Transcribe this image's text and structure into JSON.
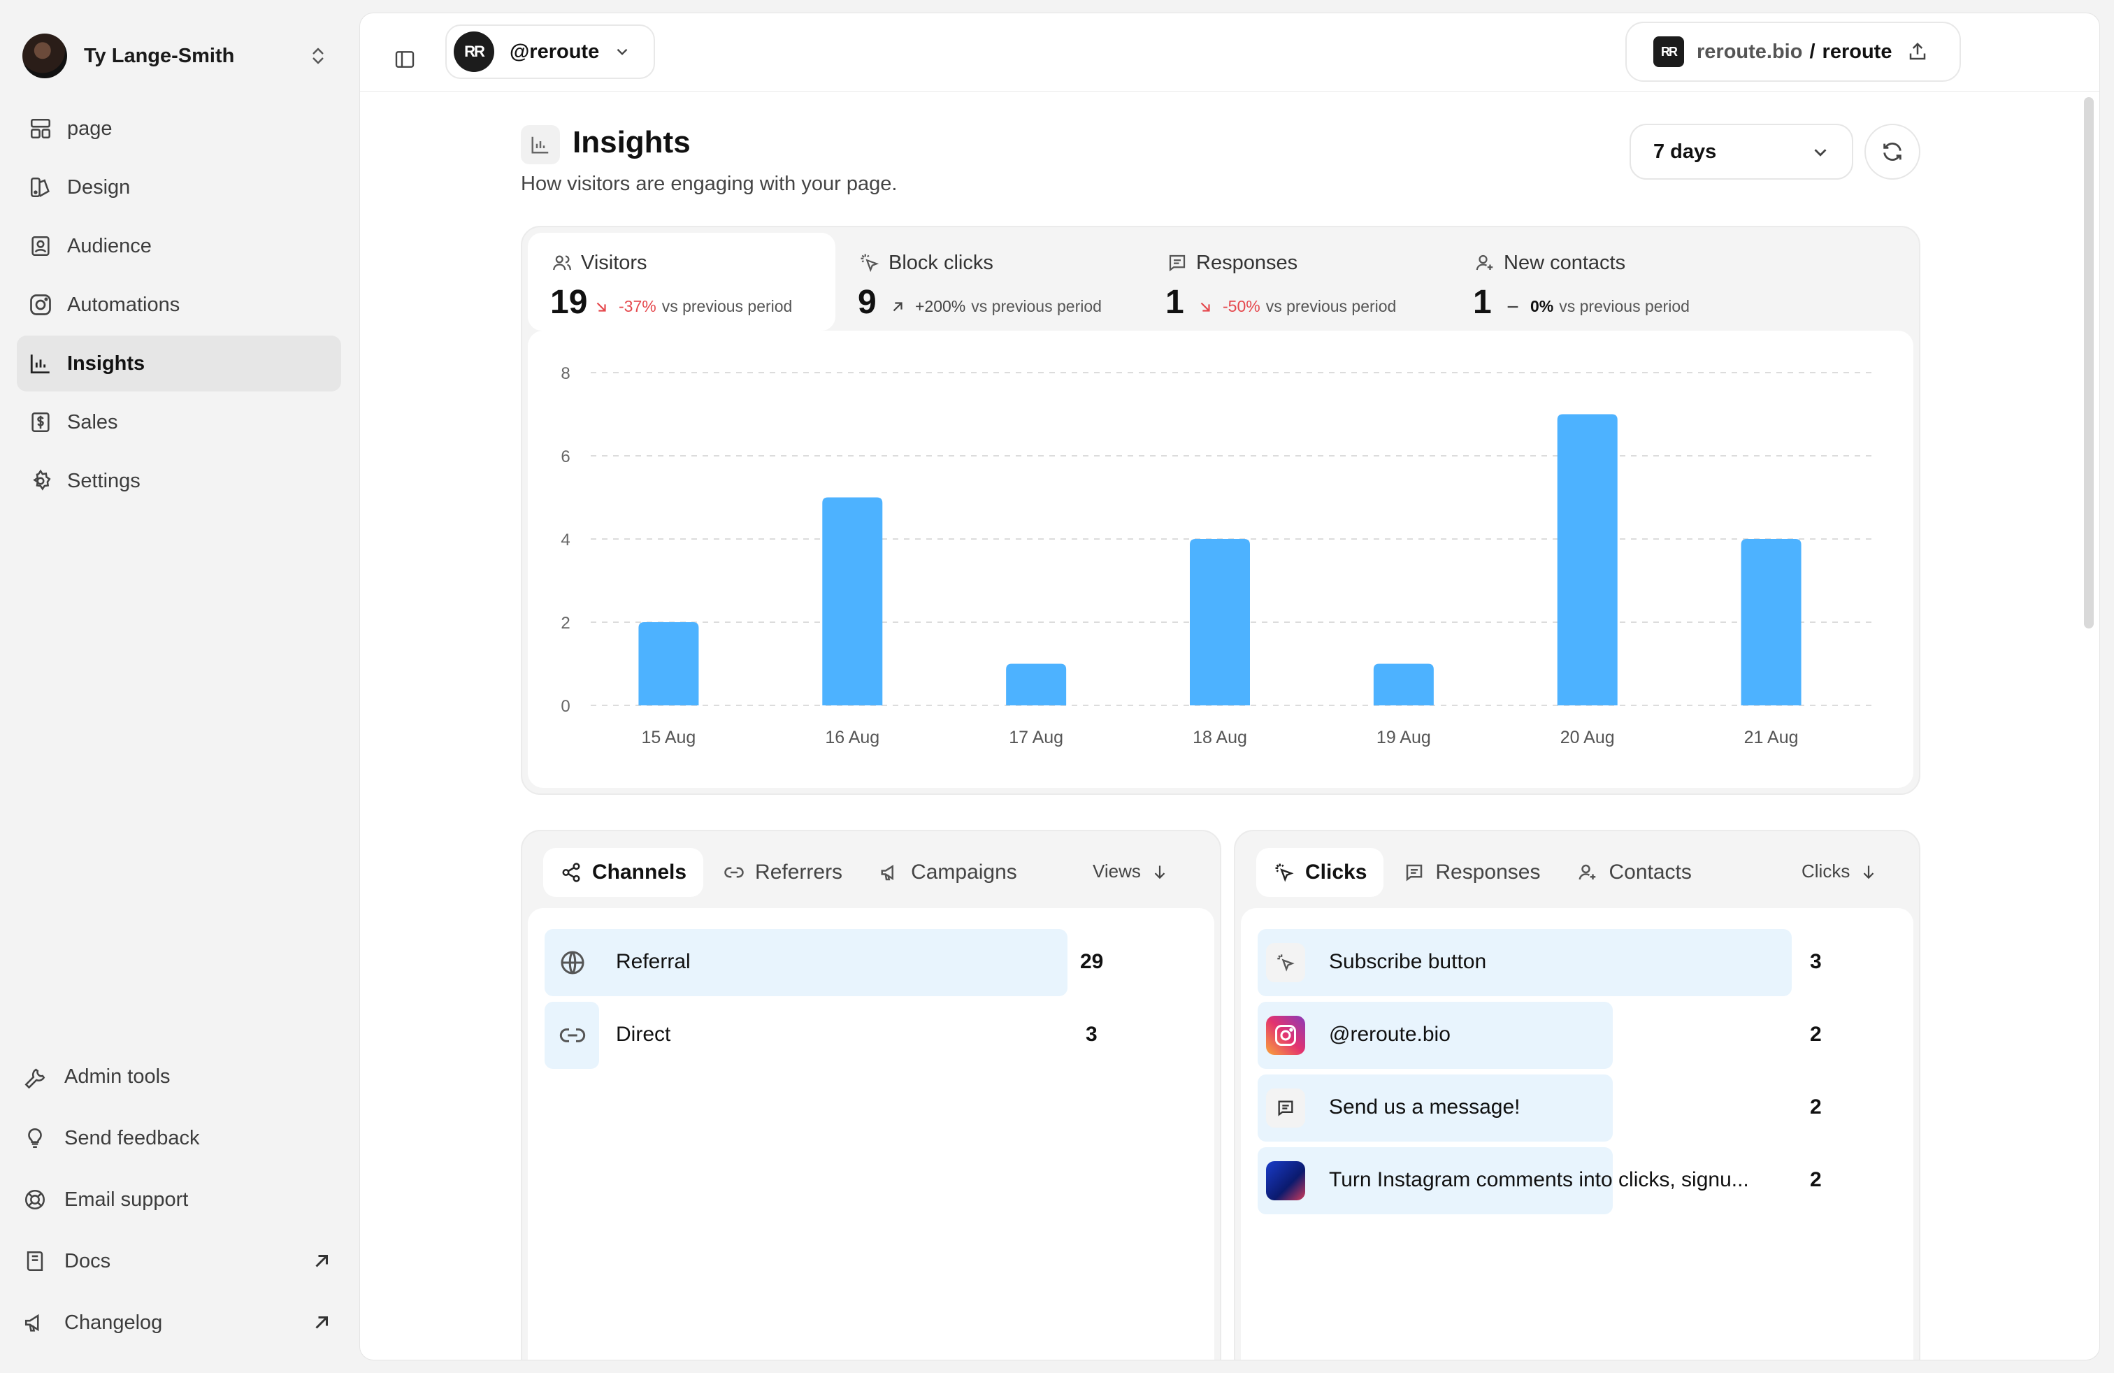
{
  "sidebar": {
    "user_name": "Ty Lange-Smith",
    "nav": [
      {
        "label": "page",
        "icon": "layout-icon"
      },
      {
        "label": "Design",
        "icon": "palette-icon"
      },
      {
        "label": "Audience",
        "icon": "contact-book-icon"
      },
      {
        "label": "Automations",
        "icon": "instagram-icon"
      },
      {
        "label": "Insights",
        "icon": "bar-chart-icon",
        "active": true
      },
      {
        "label": "Sales",
        "icon": "dollar-receipt-icon"
      },
      {
        "label": "Settings",
        "icon": "gear-icon"
      }
    ],
    "footer": [
      {
        "label": "Admin tools",
        "icon": "wrench-icon"
      },
      {
        "label": "Send feedback",
        "icon": "lightbulb-icon"
      },
      {
        "label": "Email support",
        "icon": "lifebuoy-icon"
      },
      {
        "label": "Docs",
        "icon": "book-icon",
        "external": true
      },
      {
        "label": "Changelog",
        "icon": "megaphone-icon",
        "external": true
      }
    ]
  },
  "topbar": {
    "account": "@reroute",
    "logo_text": "RR",
    "url_domain": "reroute.bio",
    "url_separator": "/",
    "url_slug": "reroute"
  },
  "header": {
    "title": "Insights",
    "subtitle": "How visitors are engaging with your page.",
    "range": "7 days"
  },
  "metrics": [
    {
      "label": "Visitors",
      "value": "19",
      "delta": "-37%",
      "delta_suffix": "vs previous period",
      "trend": "down"
    },
    {
      "label": "Block clicks",
      "value": "9",
      "delta": "+200%",
      "delta_suffix": "vs previous period",
      "trend": "up"
    },
    {
      "label": "Responses",
      "value": "1",
      "delta": "-50%",
      "delta_suffix": "vs previous period",
      "trend": "down"
    },
    {
      "label": "New contacts",
      "value": "1",
      "delta": "0%",
      "delta_suffix": "vs previous period",
      "trend": "flat"
    }
  ],
  "chart_data": {
    "type": "bar",
    "categories": [
      "15 Aug",
      "16 Aug",
      "17 Aug",
      "18 Aug",
      "19 Aug",
      "20 Aug",
      "21 Aug"
    ],
    "values": [
      2,
      5,
      1,
      4,
      1,
      7,
      4
    ],
    "yticks": [
      0,
      2,
      4,
      6,
      8
    ],
    "ylim": [
      0,
      8
    ],
    "grid": true,
    "bar_color": "#4db2ff"
  },
  "channels_card": {
    "tabs": [
      "Channels",
      "Referrers",
      "Campaigns"
    ],
    "sort_label": "Views",
    "rows": [
      {
        "label": "Referral",
        "value": "29",
        "icon": "globe-icon",
        "share": 1.0
      },
      {
        "label": "Direct",
        "value": "3",
        "icon": "link-icon",
        "share": 0.1
      }
    ]
  },
  "clicks_card": {
    "tabs": [
      "Clicks",
      "Responses",
      "Contacts"
    ],
    "sort_label": "Clicks",
    "rows": [
      {
        "label": "Subscribe button",
        "value": "3",
        "icon": "click-icon",
        "share": 1.0
      },
      {
        "label": "@reroute.bio",
        "value": "2",
        "icon": "instagram-icon",
        "share": 0.667
      },
      {
        "label": "Send us a message!",
        "value": "2",
        "icon": "message-icon",
        "share": 0.667
      },
      {
        "label": "Turn Instagram comments into clicks, signu...",
        "value": "2",
        "icon": "thumbnail-icon",
        "share": 0.667
      }
    ]
  }
}
